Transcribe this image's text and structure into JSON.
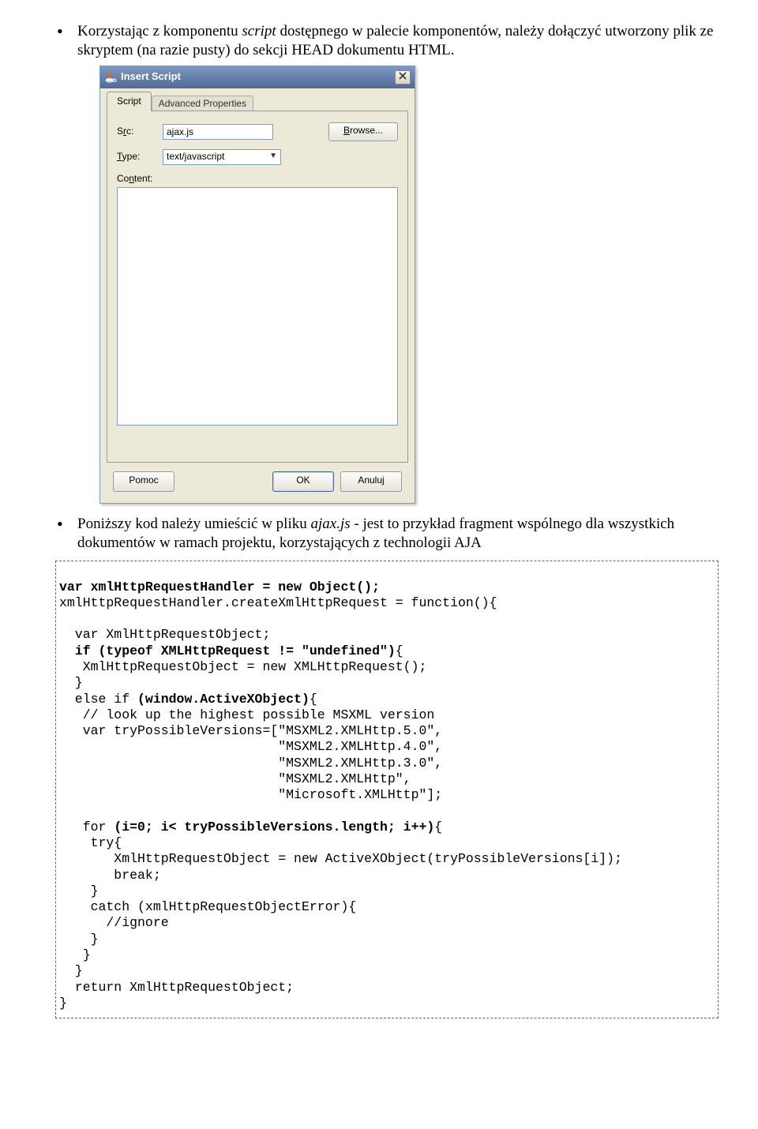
{
  "bullets": {
    "b1_pre": "Korzystając z komponentu ",
    "b1_em": "script",
    "b1_post": " dostępnego w palecie komponentów, należy dołączyć utworzony plik ze skryptem (na razie pusty) do sekcji HEAD dokumentu HTML.",
    "b2_pre": "Poniższy kod należy umieścić w pliku ",
    "b2_em": "ajax.js",
    "b2_post": " - jest to przykład fragment wspólnego dla wszystkich dokumentów w ramach projektu, korzystających z technologii AJA"
  },
  "dialog": {
    "title": "Insert Script",
    "tabs": {
      "script": "Script",
      "advanced": "Advanced Properties"
    },
    "labels": {
      "src_pre": "S",
      "src_key": "r",
      "src_post": "c:",
      "type_key": "T",
      "type_post": "ype:",
      "content_pre": "Co",
      "content_key": "n",
      "content_post": "tent:"
    },
    "src_value": "ajax.js",
    "browse_key": "B",
    "browse_post": "rowse...",
    "type_value": "text/javascript",
    "buttons": {
      "help": "Pomoc",
      "ok": "OK",
      "cancel": "Anuluj"
    }
  },
  "code": {
    "l01a": "var xmlHttpRequestHandler = new Object();",
    "l02": "xmlHttpRequestHandler.createXmlHttpRequest = function(){",
    "l03": "",
    "l04": "  var XmlHttpRequestObject;",
    "l05a": "  if (typeof XMLHttpRequest != \"undefined\"){",
    "l05_bold": "if (typeof XMLHttpRequest != \"undefined\")",
    "l05_pre": "  ",
    "l05_post": "{",
    "l06": "   XmlHttpRequestObject = new XMLHttpRequest();",
    "l07": "  }",
    "l08_pre": "  else if ",
    "l08_bold": "(window.ActiveXObject)",
    "l08_post": "{",
    "l09": "   // look up the highest possible MSXML version",
    "l10": "   var tryPossibleVersions=[\"MSXML2.XMLHttp.5.0\",",
    "l11": "                            \"MSXML2.XMLHttp.4.0\",",
    "l12": "                            \"MSXML2.XMLHttp.3.0\",",
    "l13": "                            \"MSXML2.XMLHttp\",",
    "l14": "                            \"Microsoft.XMLHttp\"];",
    "l15": "",
    "l16_pre": "   for ",
    "l16_bold": "(i=0; i< tryPossibleVersions.length; i++)",
    "l16_post": "{",
    "l17": "    try{",
    "l18": "       XmlHttpRequestObject = new ActiveXObject(tryPossibleVersions[i]);",
    "l19": "       break;",
    "l20": "    }",
    "l21": "    catch (xmlHttpRequestObjectError){",
    "l22": "      //ignore",
    "l23": "    }",
    "l24": "   }",
    "l25": "  }",
    "l26": "  return XmlHttpRequestObject;",
    "l27": "}"
  }
}
